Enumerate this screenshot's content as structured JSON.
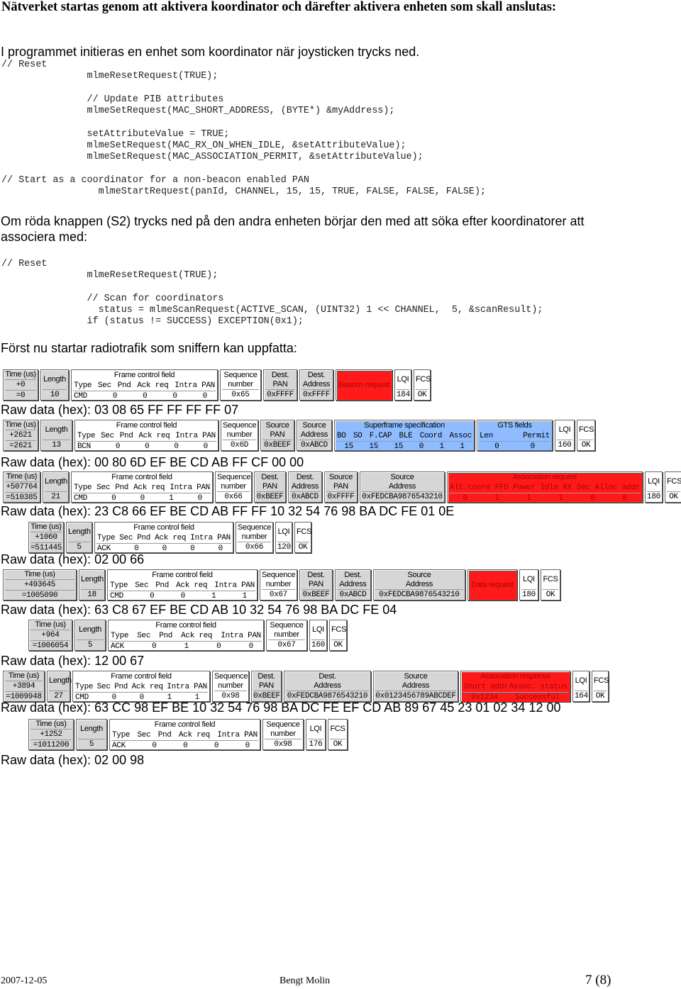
{
  "heading": "Nätverket startas genom att aktivera koordinator och därefter aktivera enheten som skall anslutas:",
  "para1": "I programmet initieras en enhet som koordinator när joysticken trycks ned.",
  "code1": [
    "// Reset",
    "               mlmeResetRequest(TRUE);",
    "",
    "               // Update PIB attributes",
    "               mlmeSetRequest(MAC_SHORT_ADDRESS, (BYTE*) &myAddress);",
    "",
    "               setAttributeValue = TRUE;",
    "               mlmeSetRequest(MAC_RX_ON_WHEN_IDLE, &setAttributeValue);",
    "               mlmeSetRequest(MAC_ASSOCIATION_PERMIT, &setAttributeValue);",
    "",
    "// Start as a coordinator for a non-beacon enabled PAN",
    "                 mlmeStartRequest(panId, CHANNEL, 15, 15, TRUE, FALSE, FALSE, FALSE);"
  ],
  "para2": "Om röda knappen (S2) trycks ned på den andra enheten börjar den med att söka efter koordinatorer att associera med:",
  "code2": [
    "// Reset",
    "               mlmeResetRequest(TRUE);",
    "",
    "               // Scan for coordinators",
    "                 status = mlmeScanRequest(ACTIVE_SCAN, (UINT32) 1 << CHANNEL,  5, &scanResult);",
    "               if (status != SUCCESS) EXCEPTION(0x1);"
  ],
  "para3": "Först nu startar radiotrafik som sniffern kan uppfatta:",
  "labels": {
    "time": "Time (us)",
    "length": "Length",
    "fcf": "Frame control field",
    "fcf_fields": [
      "Type",
      "Sec",
      "Pnd",
      "Ack req",
      "Intra PAN"
    ],
    "seq1": "Sequence",
    "seq2": "number",
    "dest_pan1": "Dest.",
    "dest_pan2": "PAN",
    "dest_addr1": "Dest.",
    "dest_addr2": "Address",
    "src_pan1": "Source",
    "src_pan2": "PAN",
    "src_addr1": "Source",
    "src_addr2": "Address",
    "lqi": "LQI",
    "fcs": "FCS",
    "superframe": "Superframe specification",
    "superframe_fields": [
      "BO",
      "SO",
      "F.CAP",
      "BLE",
      "Coord",
      "Assoc"
    ],
    "gts": "GTS fields",
    "gts_fields": [
      "Len",
      "Permit"
    ],
    "assoc_req": "Association request",
    "assoc_req_fields": [
      "Alt.coord",
      "FFD",
      "Power",
      "Idle",
      "RX",
      "Sec",
      "Alloc",
      "addr"
    ],
    "assoc_resp": "Association response",
    "assoc_resp_fields": [
      "Short addr",
      "Assoc. status"
    ],
    "raw_prefix": "Raw data (hex): "
  },
  "packets": [
    {
      "time_rel": "+0",
      "time_abs": "=0",
      "length": "10",
      "fcf": [
        "CMD",
        "0",
        "0",
        "0",
        "0"
      ],
      "seq": "0x65",
      "dest_pan": "0xFFFF",
      "dest_addr": "0xFFFF",
      "payload": "Beacon request",
      "lqi": "184",
      "fcs": "OK",
      "raw": "03 08 65 FF FF FF FF 07"
    },
    {
      "time_rel": "+2621",
      "time_abs": "=2621",
      "length": "13",
      "fcf": [
        "BCN",
        "0",
        "0",
        "0",
        "0"
      ],
      "seq": "0x6D",
      "src_pan": "0xBEEF",
      "src_addr": "0xABCD",
      "superframe": [
        "15",
        "15",
        "15",
        "0",
        "1",
        "1"
      ],
      "gts": [
        "0",
        "0"
      ],
      "lqi": "160",
      "fcs": "OK",
      "raw": "00 80 6D EF BE CD AB FF CF 00 00"
    },
    {
      "time_rel": "+507764",
      "time_abs": "=510385",
      "length": "21",
      "fcf": [
        "CMD",
        "0",
        "0",
        "1",
        "0"
      ],
      "seq": "0x66",
      "dest_pan": "0xBEEF",
      "dest_addr": "0xABCD",
      "src_pan": "0xFFFF",
      "src_addr": "0xFEDCBA9876543210",
      "assoc_req": [
        "0",
        "1",
        "1",
        "1",
        "0",
        "0"
      ],
      "lqi": "180",
      "fcs": "OK",
      "raw": "23 C8 66 EF BE CD AB FF FF 10 32 54 76 98 BA DC FE 01 0E"
    },
    {
      "time_rel": "+1060",
      "time_abs": "=511445",
      "length": "5",
      "fcf": [
        "ACK",
        "0",
        "0",
        "0",
        "0"
      ],
      "seq": "0x66",
      "lqi": "120",
      "fcs": "OK",
      "raw": "02 00 66"
    },
    {
      "time_rel": "+493645",
      "time_abs": "=1005090",
      "length": "18",
      "fcf": [
        "CMD",
        "0",
        "0",
        "1",
        "1"
      ],
      "seq": "0x67",
      "dest_pan": "0xBEEF",
      "dest_addr": "0xABCD",
      "src_addr": "0xFEDCBA9876543210",
      "payload": "Data request",
      "lqi": "180",
      "fcs": "OK",
      "raw": "63 C8 67 EF BE CD AB 10 32 54 76 98 BA DC FE 04"
    },
    {
      "time_rel": "+964",
      "time_abs": "=1006054",
      "length": "5",
      "fcf": [
        "ACK",
        "0",
        "1",
        "0",
        "0"
      ],
      "seq": "0x67",
      "lqi": "160",
      "fcs": "OK",
      "raw": "12 00 67"
    },
    {
      "time_rel": "+3894",
      "time_abs": "=1009948",
      "length": "27",
      "fcf": [
        "CMD",
        "0",
        "0",
        "1",
        "1"
      ],
      "seq": "0x98",
      "dest_pan": "0xBEEF",
      "dest_addr": "0xFEDCBA9876543210",
      "src_addr": "0x0123456789ABCDEF",
      "assoc_resp": [
        "0x1234",
        "Successful"
      ],
      "lqi": "164",
      "fcs": "OK",
      "raw": "63 CC 98 EF BE 10 32 54 76 98 BA DC FE EF CD AB 89 67 45 23 01 02 34 12 00"
    },
    {
      "time_rel": "+1252",
      "time_abs": "=1011200",
      "length": "5",
      "fcf": [
        "ACK",
        "0",
        "0",
        "0",
        "0"
      ],
      "seq": "0x98",
      "lqi": "176",
      "fcs": "OK",
      "raw": "02 00 98"
    }
  ],
  "colors": {
    "header_gray": "#d6d6d6",
    "payload_red": "#ff1a1a",
    "superframe_blue": "#8fbcff"
  },
  "footer": {
    "date": "2007-12-05",
    "author": "Bengt Molin",
    "page": "7 (8)"
  }
}
